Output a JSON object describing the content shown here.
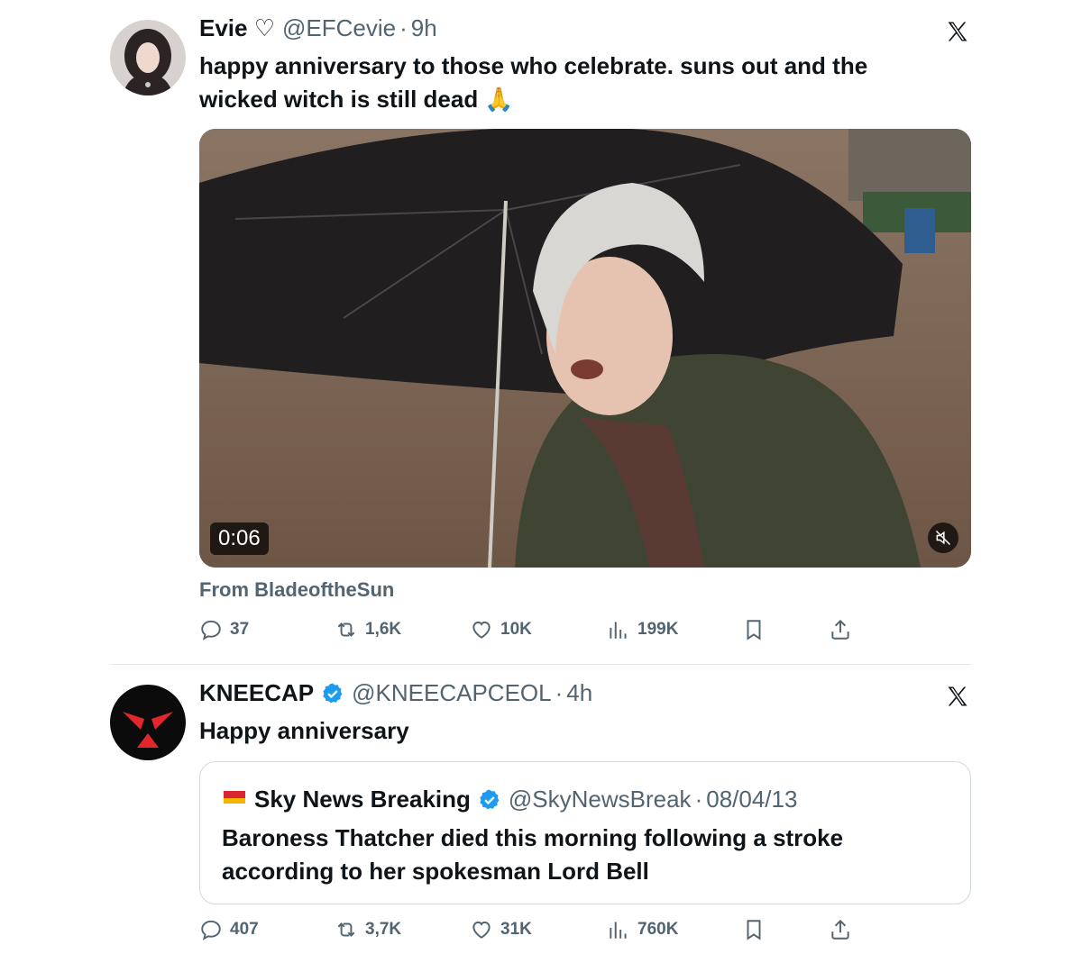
{
  "tweet1": {
    "name": "Evie ♡",
    "handle": "@EFCevie",
    "sep": "·",
    "time": "9h",
    "text": "happy anniversary to those who celebrate. suns out and the wicked witch is still dead 🙏",
    "video_time": "0:06",
    "from": "From BladeoftheSun",
    "replies": "37",
    "reposts": "1,6K",
    "likes": "10K",
    "views": "199K"
  },
  "tweet2": {
    "name": "KNEECAP",
    "handle": "@KNEECAPCEOL",
    "sep": "·",
    "time": "4h",
    "text": "Happy anniversary",
    "replies": "407",
    "reposts": "3,7K",
    "likes": "31K",
    "views": "760K",
    "quote": {
      "name": "Sky News Breaking",
      "handle": "@SkyNewsBreak",
      "sep": "·",
      "date": "08/04/13",
      "text": "Baroness Thatcher died this morning following a stroke according to her spokesman Lord Bell"
    }
  },
  "colors": {
    "text": "#0f1419",
    "secondary": "#536471",
    "verified": "#1d9bf0",
    "divider": "#e6e9eb"
  },
  "icons": [
    "x-logo-icon",
    "reply-icon",
    "repost-icon",
    "like-icon",
    "views-icon",
    "bookmark-icon",
    "share-icon",
    "verified-icon",
    "mute-icon"
  ]
}
